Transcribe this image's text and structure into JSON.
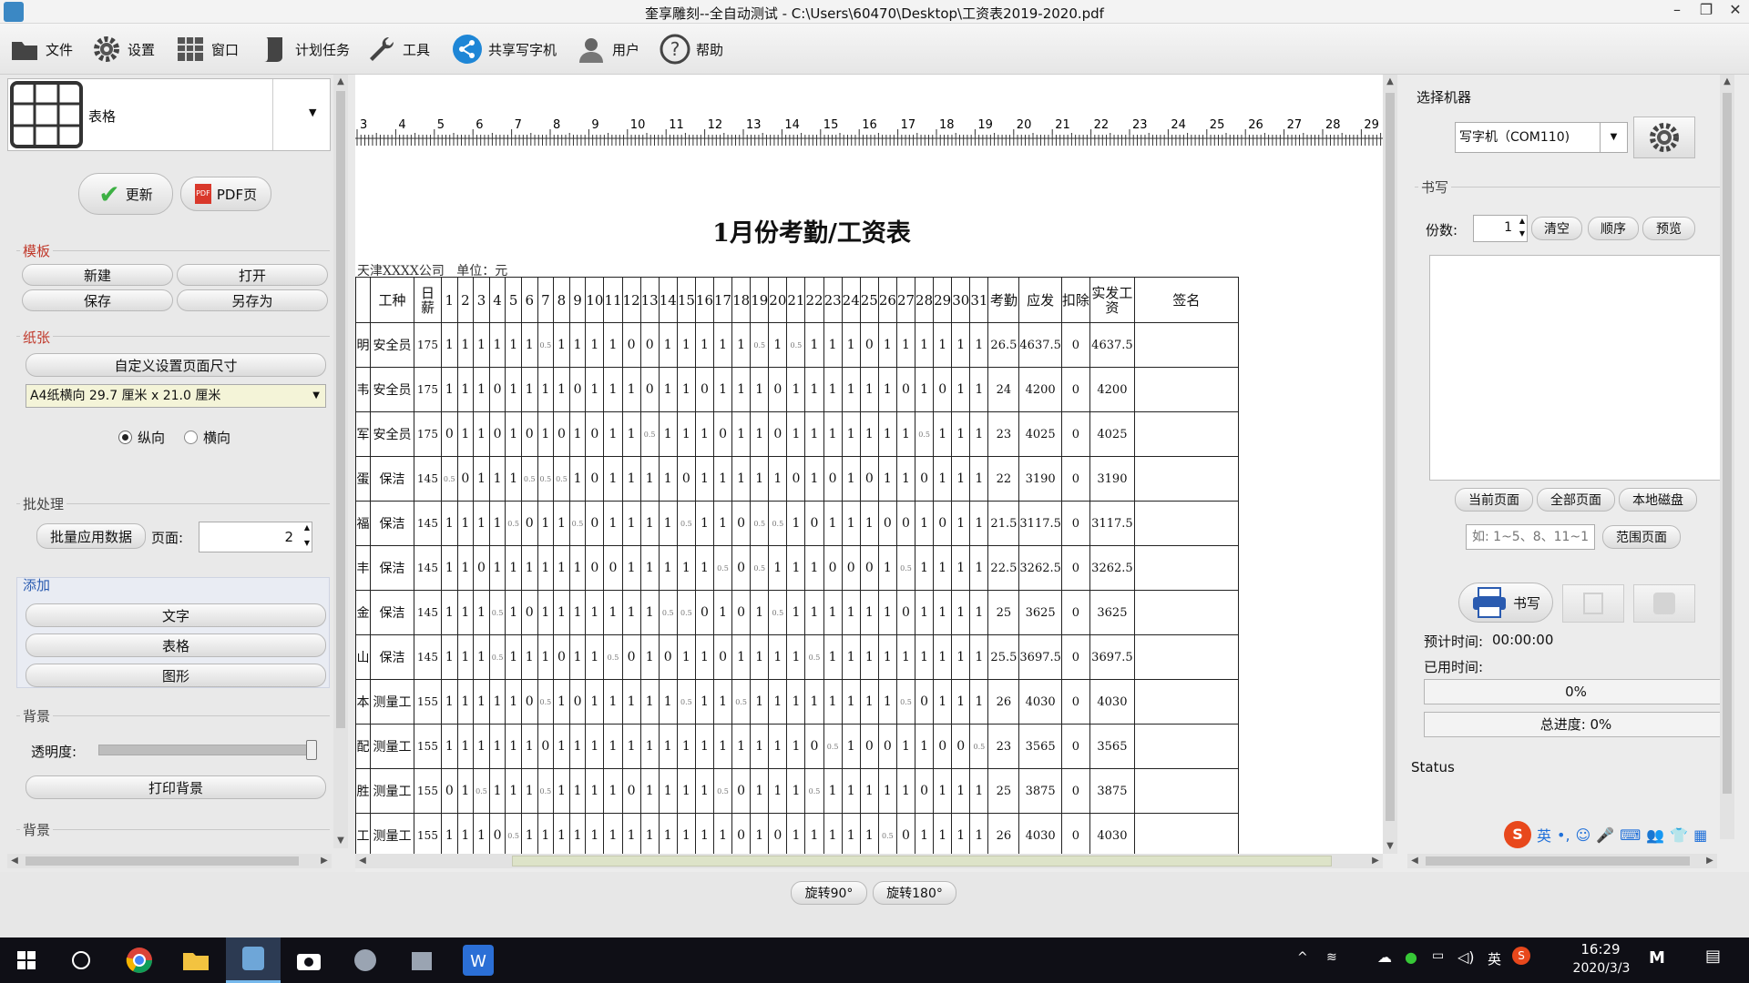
{
  "window": {
    "title": "奎享雕刻--全自动测试 - C:\\Users\\60470\\Desktop\\工资表2019-2020.pdf",
    "minimize": "–",
    "maximize": "❐",
    "close": "✕"
  },
  "menu": [
    "文件",
    "设置",
    "窗口",
    "计划任务",
    "工具",
    "共享写字机",
    "用户",
    "帮助"
  ],
  "left": {
    "template_name": "表格",
    "update_label": "更新",
    "pdf_label": "PDF页",
    "moban": {
      "title": "模板",
      "new": "新建",
      "open": "打开",
      "save": "保存",
      "save_as": "另存为"
    },
    "paper": {
      "title": "纸张",
      "custom_size": "自定义设置页面尺寸",
      "size_value": "A4纸横向 29.7 厘米 x 21.0 厘米",
      "portrait": "纵向",
      "landscape": "横向"
    },
    "batch": {
      "title": "批处理",
      "apply": "批量应用数据",
      "page_label": "页面:",
      "page_value": "2"
    },
    "add": {
      "title": "添加",
      "text": "文字",
      "table": "表格",
      "shape": "图形"
    },
    "background": {
      "title": "背景",
      "opacity_label": "透明度:",
      "opacity": 1.0,
      "print_bg": "打印背景"
    },
    "background2_title": "背景"
  },
  "document": {
    "ruler_labels": [
      "3",
      "4",
      "5",
      "6",
      "7",
      "8",
      "9",
      "10",
      "11",
      "12",
      "13",
      "14",
      "15",
      "16",
      "17",
      "18",
      "19",
      "20",
      "21",
      "22",
      "23",
      "24",
      "25",
      "26",
      "27",
      "28",
      "29"
    ],
    "title": "1月份考勤/工资表",
    "company": "天津XXXX公司",
    "unit": "单位：元",
    "header": {
      "name": "",
      "type": "工种",
      "daily": "日薪",
      "days": [
        "1",
        "2",
        "3",
        "4",
        "5",
        "6",
        "7",
        "8",
        "9",
        "10",
        "11",
        "12",
        "13",
        "14",
        "15",
        "16",
        "17",
        "18",
        "19",
        "20",
        "21",
        "22",
        "23",
        "24",
        "25",
        "26",
        "27",
        "28",
        "29",
        "30",
        "31"
      ],
      "attendance": "考勤",
      "payable": "应发",
      "deduction": "扣除",
      "actual": "实发工资",
      "sign": "签名"
    },
    "rows": [
      {
        "name": "明",
        "type": "安全员",
        "daily": "175",
        "days": [
          "1",
          "1",
          "1",
          "1",
          "1",
          "1",
          "0.5",
          "1",
          "1",
          "1",
          "1",
          "0",
          "0",
          "1",
          "1",
          "1",
          "1",
          "1",
          "0.5",
          "1",
          "0.5",
          "1",
          "1",
          "1",
          "0",
          "1",
          "1",
          "1",
          "1",
          "1",
          "1"
        ],
        "attendance": "26.5",
        "payable": "4637.5",
        "deduction": "0",
        "actual": "4637.5"
      },
      {
        "name": "韦",
        "type": "安全员",
        "daily": "175",
        "days": [
          "1",
          "1",
          "1",
          "0",
          "1",
          "1",
          "1",
          "1",
          "0",
          "1",
          "1",
          "1",
          "0",
          "1",
          "1",
          "0",
          "1",
          "1",
          "1",
          "0",
          "1",
          "1",
          "1",
          "1",
          "1",
          "1",
          "0",
          "1",
          "0",
          "1",
          "1"
        ],
        "attendance": "24",
        "payable": "4200",
        "deduction": "0",
        "actual": "4200"
      },
      {
        "name": "军",
        "type": "安全员",
        "daily": "175",
        "days": [
          "0",
          "1",
          "1",
          "0",
          "1",
          "0",
          "1",
          "0",
          "1",
          "0",
          "1",
          "1",
          "0.5",
          "1",
          "1",
          "1",
          "0",
          "1",
          "1",
          "0",
          "1",
          "1",
          "1",
          "1",
          "1",
          "1",
          "1",
          "0.5",
          "1",
          "1",
          "1"
        ],
        "attendance": "23",
        "payable": "4025",
        "deduction": "0",
        "actual": "4025"
      },
      {
        "name": "蛋",
        "type": "保洁",
        "daily": "145",
        "days": [
          "0.5",
          "0",
          "1",
          "1",
          "1",
          "0.5",
          "0.5",
          "0.5",
          "1",
          "0",
          "1",
          "1",
          "1",
          "1",
          "0",
          "1",
          "1",
          "1",
          "1",
          "1",
          "0",
          "1",
          "0",
          "1",
          "0",
          "1",
          "1",
          "0",
          "1",
          "1",
          "1"
        ],
        "attendance": "22",
        "payable": "3190",
        "deduction": "0",
        "actual": "3190"
      },
      {
        "name": "福",
        "type": "保洁",
        "daily": "145",
        "days": [
          "1",
          "1",
          "1",
          "1",
          "0.5",
          "0",
          "1",
          "1",
          "0.5",
          "0",
          "1",
          "1",
          "1",
          "1",
          "0.5",
          "1",
          "1",
          "0",
          "0.5",
          "0.5",
          "1",
          "0",
          "1",
          "1",
          "1",
          "0",
          "0",
          "1",
          "0",
          "1",
          "1"
        ],
        "attendance": "21.5",
        "payable": "3117.5",
        "deduction": "0",
        "actual": "3117.5"
      },
      {
        "name": "丰",
        "type": "保洁",
        "daily": "145",
        "days": [
          "1",
          "1",
          "0",
          "1",
          "1",
          "1",
          "1",
          "1",
          "1",
          "0",
          "0",
          "1",
          "1",
          "1",
          "1",
          "1",
          "0.5",
          "0",
          "0.5",
          "1",
          "1",
          "1",
          "0",
          "0",
          "0",
          "1",
          "0.5",
          "1",
          "1",
          "1",
          "1"
        ],
        "attendance": "22.5",
        "payable": "3262.5",
        "deduction": "0",
        "actual": "3262.5"
      },
      {
        "name": "金",
        "type": "保洁",
        "daily": "145",
        "days": [
          "1",
          "1",
          "1",
          "0.5",
          "1",
          "0",
          "1",
          "1",
          "1",
          "1",
          "1",
          "1",
          "1",
          "0.5",
          "0.5",
          "0",
          "1",
          "0",
          "1",
          "0.5",
          "1",
          "1",
          "1",
          "1",
          "1",
          "1",
          "0",
          "1",
          "1",
          "1",
          "1"
        ],
        "attendance": "25",
        "payable": "3625",
        "deduction": "0",
        "actual": "3625"
      },
      {
        "name": "山",
        "type": "保洁",
        "daily": "145",
        "days": [
          "1",
          "1",
          "1",
          "0.5",
          "1",
          "1",
          "1",
          "0",
          "1",
          "1",
          "0.5",
          "0",
          "1",
          "0",
          "1",
          "1",
          "0",
          "1",
          "1",
          "1",
          "1",
          "0.5",
          "1",
          "1",
          "1",
          "1",
          "1",
          "1",
          "1",
          "1",
          "1"
        ],
        "attendance": "25.5",
        "payable": "3697.5",
        "deduction": "0",
        "actual": "3697.5"
      },
      {
        "name": "本",
        "type": "测量工",
        "daily": "155",
        "days": [
          "1",
          "1",
          "1",
          "1",
          "1",
          "0",
          "0.5",
          "1",
          "0",
          "1",
          "1",
          "1",
          "1",
          "1",
          "0.5",
          "1",
          "1",
          "0.5",
          "1",
          "1",
          "1",
          "1",
          "1",
          "1",
          "1",
          "1",
          "0.5",
          "0",
          "1",
          "1",
          "1"
        ],
        "attendance": "26",
        "payable": "4030",
        "deduction": "0",
        "actual": "4030"
      },
      {
        "name": "配",
        "type": "测量工",
        "daily": "155",
        "days": [
          "1",
          "1",
          "1",
          "1",
          "1",
          "1",
          "0",
          "1",
          "1",
          "1",
          "1",
          "1",
          "1",
          "1",
          "1",
          "1",
          "1",
          "1",
          "1",
          "1",
          "1",
          "0",
          "0.5",
          "1",
          "0",
          "0",
          "1",
          "1",
          "0",
          "0",
          "0.5"
        ],
        "attendance": "23",
        "payable": "3565",
        "deduction": "0",
        "actual": "3565"
      },
      {
        "name": "胜",
        "type": "测量工",
        "daily": "155",
        "days": [
          "0",
          "1",
          "0.5",
          "1",
          "1",
          "1",
          "0.5",
          "1",
          "1",
          "1",
          "1",
          "0",
          "1",
          "1",
          "1",
          "1",
          "0.5",
          "0",
          "1",
          "1",
          "1",
          "0.5",
          "1",
          "1",
          "1",
          "1",
          "1",
          "0",
          "1",
          "1",
          "1"
        ],
        "attendance": "25",
        "payable": "3875",
        "deduction": "0",
        "actual": "3875"
      },
      {
        "name": "工",
        "type": "测量工",
        "daily": "155",
        "days": [
          "1",
          "1",
          "1",
          "0",
          "0.5",
          "1",
          "1",
          "1",
          "1",
          "1",
          "1",
          "1",
          "1",
          "1",
          "1",
          "1",
          "1",
          "0",
          "1",
          "0",
          "1",
          "1",
          "1",
          "1",
          "1",
          "0.5",
          "0",
          "1",
          "1",
          "1",
          "1"
        ],
        "attendance": "26",
        "payable": "4030",
        "deduction": "0",
        "actual": "4030"
      }
    ]
  },
  "bottom": {
    "rotate90": "旋转90°",
    "rotate180": "旋转180°"
  },
  "right": {
    "select_machine": "选择机器",
    "machine_value": "写字机（COM110)",
    "write_title": "书写",
    "copies_label": "份数:",
    "copies_value": "1",
    "clear": "清空",
    "order": "顺序",
    "preview": "预览",
    "current_page": "当前页面",
    "all_pages": "全部页面",
    "local_disk": "本地磁盘",
    "range_placeholder": "如: 1~5、8、11~13",
    "range_page": "范围页面",
    "write_btn": "书写",
    "est_time_label": "预计时间:",
    "est_time": "00:00:00",
    "used_time_label": "已用时间:",
    "progress_label": "0%",
    "progress": 0,
    "total_label": "总进度: 0%",
    "total_progress": 0,
    "status": "Status"
  },
  "ime": {
    "lang": "英",
    "punct": "•,",
    "symbols": [
      "☺",
      "🎤",
      "⌨",
      "👥",
      "👕",
      "▦"
    ]
  },
  "taskbar": {
    "ime_lang": "英",
    "time": "16:29",
    "date": "2020/3/3"
  },
  "colors": {
    "accent": "#2a5bb0",
    "group_red": "#c0392b",
    "taskbar": "#0f0f16",
    "check_green": "#3cb043"
  }
}
